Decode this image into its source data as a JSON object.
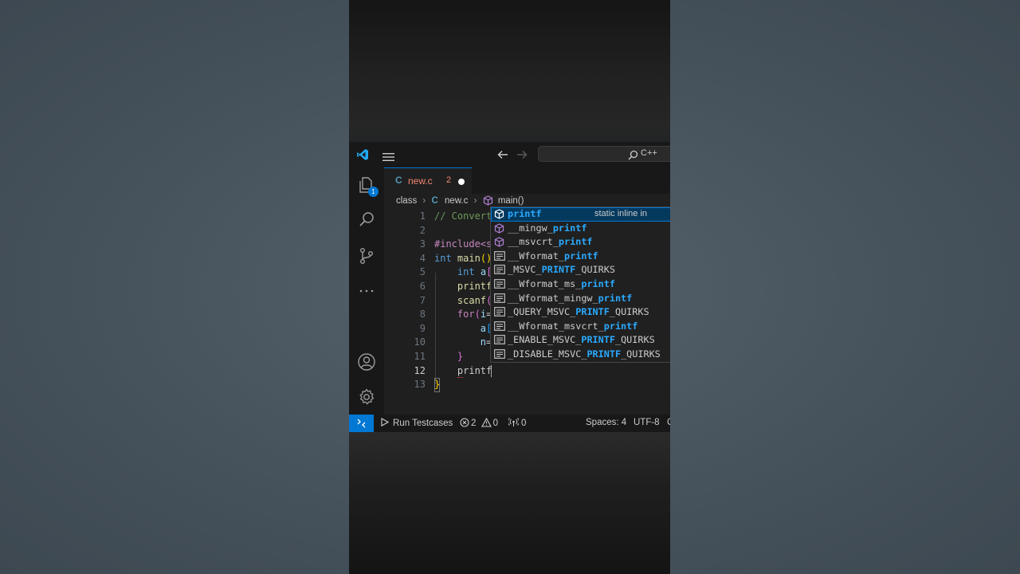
{
  "titlebar": {
    "search_text": "C++"
  },
  "activity": {
    "explorer_badge": "1"
  },
  "tab": {
    "icon_letter": "C",
    "filename": "new.c",
    "problem_count": "2"
  },
  "breadcrumb": {
    "folder": "class",
    "file_icon": "C",
    "file": "new.c",
    "symbol": "main()"
  },
  "editor": {
    "line_numbers": [
      "1",
      "2",
      "3",
      "4",
      "5",
      "6",
      "7",
      "8",
      "9",
      "10",
      "11",
      "12",
      "13"
    ],
    "lines": [
      "// Convert",
      "",
      "#include<s",
      "int main()",
      "    int a[",
      "    printf",
      "    scanf(",
      "    for(i=",
      "        a[",
      "        n=",
      "    }",
      "    printf",
      "}"
    ]
  },
  "suggestions": [
    {
      "pre": "",
      "hl": "printf",
      "post": "",
      "kind": "function",
      "detail": "static inline in"
    },
    {
      "pre": "__mingw_",
      "hl": "printf",
      "post": "",
      "kind": "function"
    },
    {
      "pre": "__msvcrt_",
      "hl": "printf",
      "post": "",
      "kind": "function"
    },
    {
      "pre": "__Wformat_",
      "hl": "printf",
      "post": "",
      "kind": "text"
    },
    {
      "pre": "_MSVC_",
      "hl": "PRINTF",
      "post": "_QUIRKS",
      "kind": "text"
    },
    {
      "pre": "__Wformat_ms_",
      "hl": "printf",
      "post": "",
      "kind": "text"
    },
    {
      "pre": "__Wformat_mingw_",
      "hl": "printf",
      "post": "",
      "kind": "text"
    },
    {
      "pre": "_QUERY_MSVC_",
      "hl": "PRINTF",
      "post": "_QUIRKS",
      "kind": "text"
    },
    {
      "pre": "__Wformat_msvcrt_",
      "hl": "printf",
      "post": "",
      "kind": "text"
    },
    {
      "pre": "_ENABLE_MSVC_",
      "hl": "PRINTF",
      "post": "_QUIRKS",
      "kind": "text"
    },
    {
      "pre": "_DISABLE_MSVC_",
      "hl": "PRINTF",
      "post": "_QUIRKS",
      "kind": "text"
    }
  ],
  "statusbar": {
    "run_label": "Run Testcases",
    "errors": "2",
    "warnings": "0",
    "ports": "0",
    "spaces": "Spaces: 4",
    "encoding": "UTF-8"
  },
  "colors": {
    "accent": "#0078d4",
    "error": "#f48771",
    "match_highlight": "#2aaaff",
    "keyword": "#569cd6",
    "control": "#c586c0",
    "function": "#dcdcaa",
    "comment": "#6a9955"
  }
}
